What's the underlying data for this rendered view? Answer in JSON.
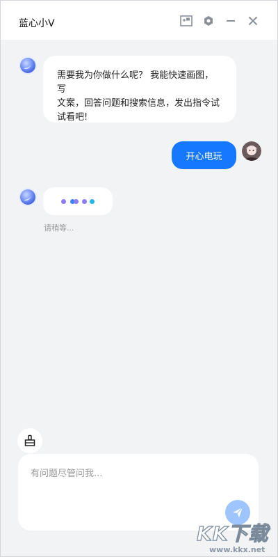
{
  "window": {
    "title": "蓝心小V"
  },
  "titlebar": {
    "buttons": [
      {
        "name": "pin-window-icon"
      },
      {
        "name": "settings-icon"
      },
      {
        "name": "minimize-icon"
      },
      {
        "name": "close-icon"
      }
    ]
  },
  "messages": [
    {
      "role": "assistant",
      "text_line1": "需要我为你做什么呢？ 我能快速画图，写",
      "text_line2": "文案，回答问题和搜索信息，发出指令试",
      "text_line3": "试看吧!"
    },
    {
      "role": "user",
      "text": "开心电玩"
    },
    {
      "role": "assistant",
      "status": "typing",
      "waiting_text": "请稍等..."
    }
  ],
  "colors": {
    "accent": "#1677ff",
    "send_button": "#9ec5fe",
    "background": "#f2f3f5",
    "typing_dots": [
      "#8b7cf6",
      "#3b82f6",
      "#8b7cf6",
      "#22b8e6"
    ]
  },
  "composer": {
    "placeholder": "有问题尽管问我...",
    "value": "",
    "clear_icon": "broom-icon",
    "send_icon": "send-icon"
  },
  "watermark": {
    "logo": "KK下载",
    "url": "www.kkx.net"
  }
}
